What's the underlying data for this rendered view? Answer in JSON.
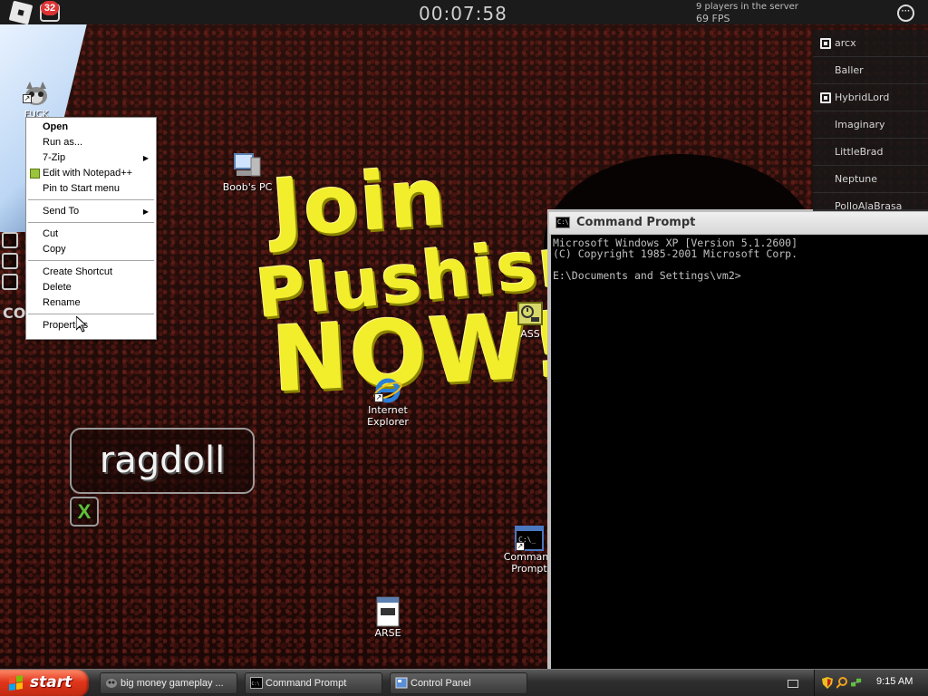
{
  "game_bar": {
    "notification_count": "32",
    "timer": "00:07:58",
    "players_in_server": "9 players in the server",
    "fps": "69 FPS",
    "menu_icon": "more-icon"
  },
  "player_list": [
    {
      "name": "arcx",
      "badge": true
    },
    {
      "name": "Baller",
      "badge": false
    },
    {
      "name": "HybridLord",
      "badge": true
    },
    {
      "name": "Imaginary",
      "badge": false
    },
    {
      "name": "LittleBrad",
      "badge": false
    },
    {
      "name": "Neptune",
      "badge": false
    },
    {
      "name": "PolloAlaBrasa",
      "badge": false
    }
  ],
  "poster": {
    "line1": "Join",
    "line2": "Plushism",
    "line3": "NOW!"
  },
  "desktop_icons": {
    "fuck": "FUCK",
    "boobs_pc": "Boob's PC",
    "ass": "ASS",
    "internet_explorer": "Internet Explorer",
    "command_prompt": "Command Prompt",
    "arse": "ARSE"
  },
  "context_menu": {
    "open": "Open",
    "run_as": "Run as...",
    "seven_zip": "7-Zip",
    "edit_notepad": "Edit with Notepad++",
    "pin_start": "Pin to Start menu",
    "send_to": "Send To",
    "cut": "Cut",
    "copy": "Copy",
    "create_shortcut": "Create Shortcut",
    "delete": "Delete",
    "rename": "Rename",
    "properties": "Properties"
  },
  "ragdoll": {
    "label": "ragdoll",
    "toggle": "X"
  },
  "side_text": "CO",
  "cmd": {
    "title": "Command Prompt",
    "icon_text": "C:\\",
    "line1": "Microsoft Windows XP [Version 5.1.2600]",
    "line2": "(C) Copyright 1985-2001 Microsoft Corp.",
    "line3": "",
    "line4": "E:\\Documents and Settings\\vm2>"
  },
  "taskbar": {
    "start": "start",
    "tasks": [
      {
        "label": "big money gameplay ..."
      },
      {
        "label": "Command Prompt"
      },
      {
        "label": "Control Panel"
      }
    ],
    "clock": "9:15 AM"
  },
  "colors": {
    "poster_yellow": "#f3ee2c",
    "start_red": "#e0351a",
    "cmd_text": "#c0c0c0"
  }
}
